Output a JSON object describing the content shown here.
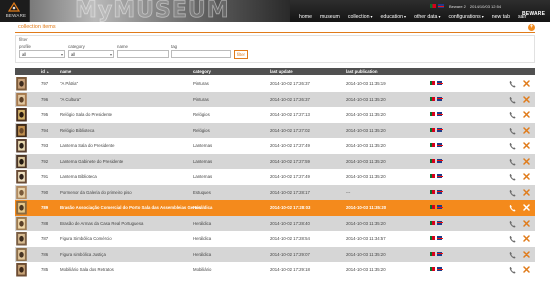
{
  "header": {
    "brand_name": "BEWARE",
    "banner_text": "MyMUSEUM",
    "session_user": "Beware 2",
    "session_date": "2014/10/03 12:54",
    "right_brand": "BEWARE"
  },
  "nav": [
    {
      "label": "home",
      "has_menu": false
    },
    {
      "label": "museum",
      "has_menu": false
    },
    {
      "label": "collection",
      "has_menu": true
    },
    {
      "label": "education",
      "has_menu": true
    },
    {
      "label": "other data",
      "has_menu": true
    },
    {
      "label": "configurations",
      "has_menu": true
    },
    {
      "label": "new tab",
      "has_menu": false
    },
    {
      "label": "sair",
      "has_menu": false
    }
  ],
  "page": {
    "title": "collection items",
    "collapse_icon": "+"
  },
  "filter": {
    "legend": "filter",
    "profile_label": "profile",
    "profile_value": "all",
    "category_label": "category",
    "category_value": "all",
    "name_label": "name",
    "name_value": "",
    "tag_label": "tag",
    "tag_value": "",
    "button_label": "filter"
  },
  "table": {
    "columns": {
      "id": "id",
      "name": "name",
      "category": "category",
      "last_update": "last update",
      "last_publication": "last publication"
    },
    "rows": [
      {
        "id": "797",
        "name": "\"A Pátria\"",
        "category": "Pinturas",
        "last_update": "2014-10-02 17:26:37",
        "last_publication": "2014-10-03 11:35:19",
        "thumb": [
          "#7d5b3a",
          "#c9a27a",
          "#3e2c1e"
        ],
        "selected": false
      },
      {
        "id": "796",
        "name": "\"A Cultura\"",
        "category": "Pinturas",
        "last_update": "2014-10-02 17:26:37",
        "last_publication": "2014-10-03 11:35:20",
        "thumb": [
          "#a67a4f",
          "#e0c6a0",
          "#5b3f26"
        ],
        "selected": false
      },
      {
        "id": "795",
        "name": "Relógio Sala do Presidente",
        "category": "Relógios",
        "last_update": "2014-10-02 17:27:13",
        "last_publication": "2014-10-03 11:35:20",
        "thumb": [
          "#4a3020",
          "#d4b26a",
          "#2a1a10"
        ],
        "selected": false
      },
      {
        "id": "794",
        "name": "Relógio Biblioteca",
        "category": "Relógios",
        "last_update": "2014-10-02 17:27:02",
        "last_publication": "2014-10-03 11:35:20",
        "thumb": [
          "#3e2a1a",
          "#c09050",
          "#6b4a2a"
        ],
        "selected": false
      },
      {
        "id": "793",
        "name": "Lanterna Sala do Presidente",
        "category": "Lanternas",
        "last_update": "2014-10-02 17:27:49",
        "last_publication": "2014-10-03 11:35:20",
        "thumb": [
          "#5a4030",
          "#e8d8b0",
          "#2a2018"
        ],
        "selected": false
      },
      {
        "id": "792",
        "name": "Lanterna Gabinete do Presidente",
        "category": "Lanternas",
        "last_update": "2014-10-02 17:27:59",
        "last_publication": "2014-10-03 11:35:20",
        "thumb": [
          "#4c3626",
          "#d8c49a",
          "#221810"
        ],
        "selected": false
      },
      {
        "id": "791",
        "name": "Lanterna Biblioteca",
        "category": "Lanternas",
        "last_update": "2014-10-02 17:27:49",
        "last_publication": "2014-10-03 11:35:20",
        "thumb": [
          "#6a4c36",
          "#efe0c0",
          "#30221a"
        ],
        "selected": false
      },
      {
        "id": "790",
        "name": "Pormenor da Galeria do primeiro piso",
        "category": "Estuques",
        "last_update": "2014-10-02 17:28:17",
        "last_publication": "---",
        "thumb": [
          "#b08a60",
          "#e8d2aa",
          "#7a5a3a"
        ],
        "selected": false
      },
      {
        "id": "789",
        "name": "Brasão Associação Comercial do Porto Sala das Assembleias Gerais",
        "category": "Heráldica",
        "last_update": "2014-10-02 17:28:03",
        "last_publication": "2014-10-03 11:35:20",
        "thumb": [
          "#8a6a40",
          "#e6c88a",
          "#4a3420"
        ],
        "selected": true
      },
      {
        "id": "788",
        "name": "Brasão de Armas da Casa Real Portuguesa",
        "category": "Heráldica",
        "last_update": "2014-10-02 17:28:40",
        "last_publication": "2014-10-03 11:35:20",
        "thumb": [
          "#9c7a50",
          "#f0d8a8",
          "#5a4028"
        ],
        "selected": false
      },
      {
        "id": "787",
        "name": "Figura Simbólica Comércio",
        "category": "Heráldica",
        "last_update": "2014-10-02 17:28:54",
        "last_publication": "2014-10-03 11:34:57",
        "thumb": [
          "#7a5e44",
          "#d8bc92",
          "#3c2c1e"
        ],
        "selected": false
      },
      {
        "id": "786",
        "name": "Figura simbólica Justiça",
        "category": "Heráldica",
        "last_update": "2014-10-02 17:29:07",
        "last_publication": "2014-10-03 11:35:20",
        "thumb": [
          "#8c6e4a",
          "#e2c89c",
          "#463424"
        ],
        "selected": false
      },
      {
        "id": "785",
        "name": "Mobiliário Sala dos Retratos",
        "category": "Mobiliário",
        "last_update": "2014-10-02 17:29:18",
        "last_publication": "2014-10-03 11:35:20",
        "thumb": [
          "#6e4e34",
          "#c8a478",
          "#3a2618"
        ],
        "selected": false
      }
    ]
  },
  "icons": {
    "edit": "phone-handset-icon",
    "delete": "delete-x-icon",
    "flag_pt": "portugal-flag-icon",
    "flag_gb": "uk-flag-icon"
  },
  "colors": {
    "accent": "#f48a1c",
    "header_bg": "#1a1a1a",
    "table_head_bg": "#505050",
    "row_alt_bg": "#d6d6d6"
  }
}
